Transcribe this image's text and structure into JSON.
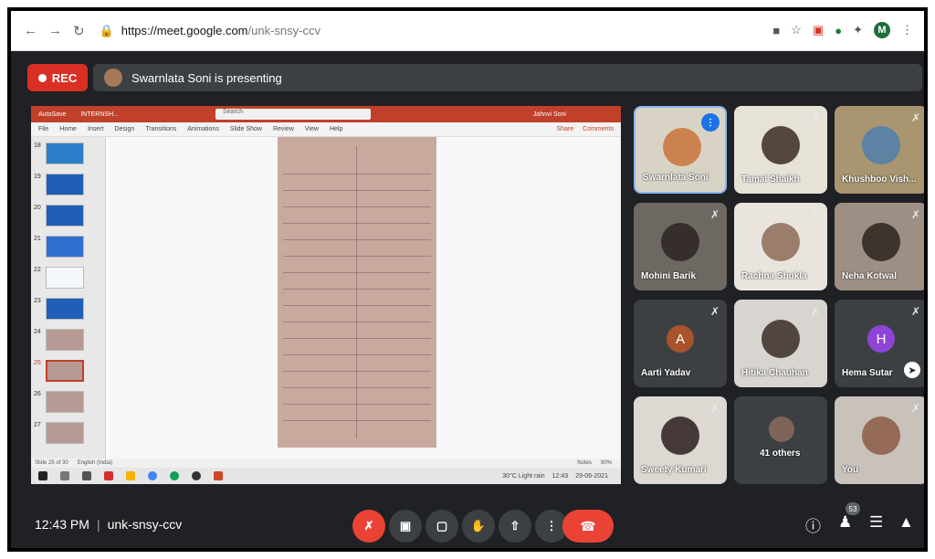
{
  "browser": {
    "url_host": "https://meet.google.com",
    "url_path": "/unk-snsy-ccv",
    "profile_initial": "M"
  },
  "meet": {
    "rec_label": "REC",
    "presenting_text": "Swarnlata Soni is presenting"
  },
  "ppt": {
    "app_name": "AutoSave",
    "doc_name": "INTERNSH...",
    "search_placeholder": "Search",
    "user": "Jahnvi Soni",
    "menu": [
      "File",
      "Home",
      "Insert",
      "Design",
      "Transitions",
      "Animations",
      "Slide Show",
      "Review",
      "View",
      "Help"
    ],
    "share": "Share",
    "comments": "Comments",
    "slide_numbers": [
      "18",
      "19",
      "20",
      "21",
      "22",
      "23",
      "24",
      "25",
      "26",
      "27"
    ],
    "status": "Slide 25 of 30",
    "language": "English (India)",
    "notes": "Notes",
    "zoom": "90%",
    "weather": "30°C Light rain",
    "clock_time": "12:43",
    "clock_date": "29-06-2021"
  },
  "participants": [
    {
      "name": "Swarnlata Soni",
      "state": "speaking"
    },
    {
      "name": "Tamal Shaikh",
      "state": "muted"
    },
    {
      "name": "Khushboo Vish...",
      "state": "muted"
    },
    {
      "name": "Mohini Barik",
      "state": "muted"
    },
    {
      "name": "Rachna Shukla",
      "state": "muted"
    },
    {
      "name": "Neha Kotwal",
      "state": "muted"
    },
    {
      "name": "Aarti Yadav",
      "state": "muted",
      "initial": "A"
    },
    {
      "name": "Hitika Chauhan",
      "state": "muted"
    },
    {
      "name": "Hema Sutar",
      "state": "muted",
      "initial": "H"
    },
    {
      "name": "Sweety Kumari",
      "state": "muted"
    },
    {
      "name": "41 others",
      "state": "group"
    },
    {
      "name": "You",
      "state": "muted"
    }
  ],
  "bottombar": {
    "time": "12:43 PM",
    "separator": "|",
    "meeting_code": "unk-snsy-ccv",
    "people_count": "53"
  },
  "colors": {
    "meet_bg": "#202124",
    "tile_bg": "#3c4043",
    "red": "#ea4335",
    "ppt_red": "#c0402a",
    "speaking_blue": "#1a73e8"
  }
}
